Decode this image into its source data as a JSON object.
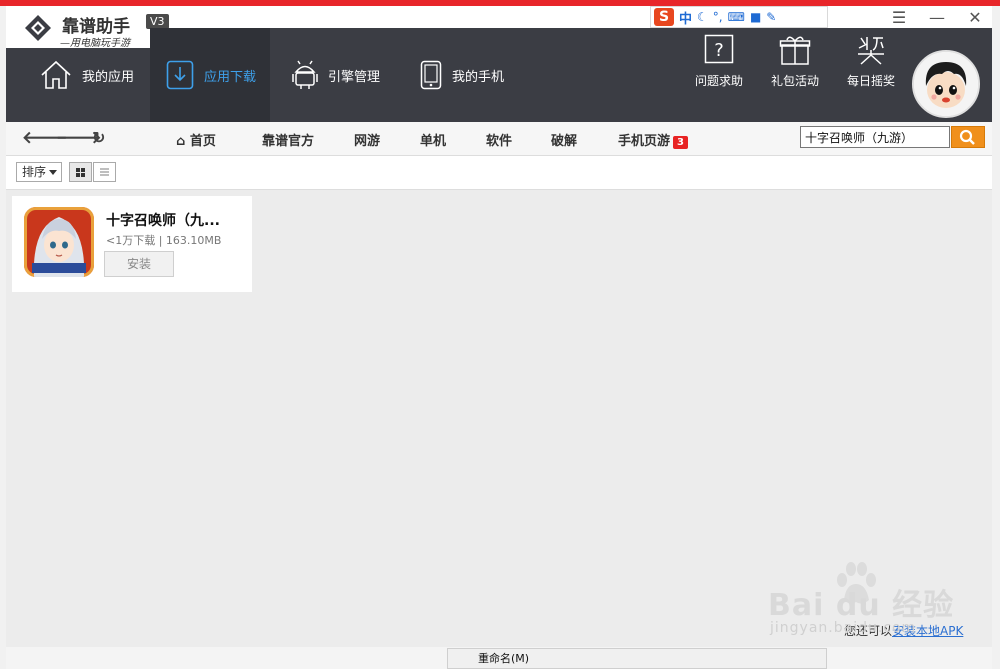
{
  "app": {
    "name": "靠谱助手",
    "version": "V3",
    "slogan": "—用电脑玩手游"
  },
  "ime": {
    "zh": "中",
    "icons": [
      "moon-icon",
      "punctuation-icon",
      "keyboard-icon",
      "skin-icon",
      "settings-icon"
    ]
  },
  "nav": {
    "items": [
      {
        "label": "我的应用",
        "icon": "home-icon"
      },
      {
        "label": "应用下载",
        "icon": "download-icon",
        "active": true
      },
      {
        "label": "引擎管理",
        "icon": "android-icon"
      },
      {
        "label": "我的手机",
        "icon": "phone-icon"
      }
    ],
    "tools": [
      {
        "label": "问题求助",
        "icon": "help-icon"
      },
      {
        "label": "礼包活动",
        "icon": "gift-icon"
      },
      {
        "label": "每日摇奖",
        "icon": "lottery-icon"
      }
    ]
  },
  "subnav": {
    "home": "首页",
    "cats": [
      "靠谱官方",
      "网游",
      "单机",
      "软件",
      "破解"
    ],
    "mobile": "手机页游",
    "mobile_badge": "3",
    "search_value": "十字召唤师（九游）"
  },
  "filter": {
    "sort_label": "排序"
  },
  "apps": [
    {
      "name": "十字召唤师（九...",
      "downloads": "<1万下载",
      "size": "163.10MB",
      "action": "安装"
    }
  ],
  "footer": {
    "prefix": "您还可以",
    "link": "安装本地APK"
  },
  "context_menu": {
    "item": "重命名(M)"
  },
  "watermark": {
    "logo": "Bai du 经验",
    "url": "jingyan.baidu.com"
  },
  "colors": {
    "nav_bg": "#3b3d44",
    "accent": "#3ea0ea",
    "search_btn": "#f0901c",
    "badge": "#e82323",
    "top_line": "#e8262a"
  }
}
